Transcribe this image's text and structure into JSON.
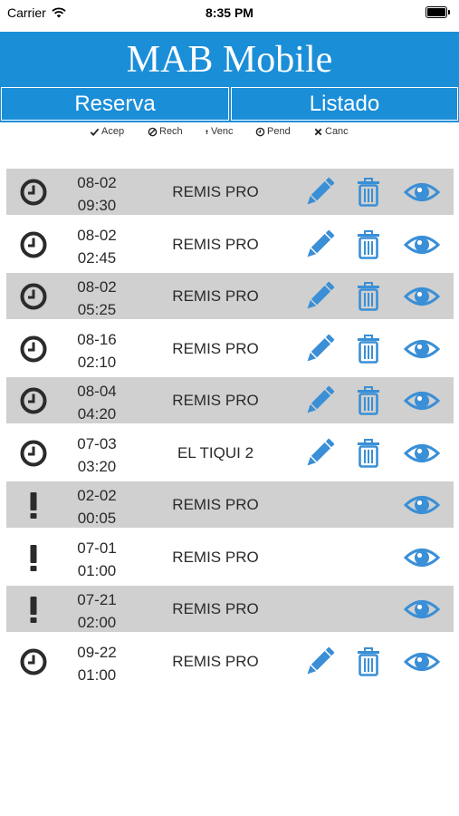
{
  "status_bar": {
    "carrier": "Carrier",
    "time": "8:35 PM"
  },
  "header": {
    "title": "MAB Mobile",
    "tabs": [
      {
        "label": "Reserva"
      },
      {
        "label": "Listado"
      }
    ]
  },
  "legend": [
    {
      "icon": "check-icon",
      "label": "Acep"
    },
    {
      "icon": "ban-icon",
      "label": "Rech"
    },
    {
      "icon": "exclamation-icon",
      "label": "Venc"
    },
    {
      "icon": "clock-icon",
      "label": "Pend"
    },
    {
      "icon": "x-icon",
      "label": "Canc"
    }
  ],
  "colors": {
    "header": "#1b8ed8",
    "action_icons": "#3a8fd6",
    "row_shade": "#d0d0d0"
  },
  "reservations": [
    {
      "date": "08-02",
      "time": "09:30",
      "company": "REMIS PRO",
      "status": "pending",
      "status_icon": "clock-icon",
      "editable": true
    },
    {
      "date": "08-02",
      "time": "02:45",
      "company": "REMIS PRO",
      "status": "pending",
      "status_icon": "clock-icon",
      "editable": true
    },
    {
      "date": "08-02",
      "time": "05:25",
      "company": "REMIS PRO",
      "status": "pending",
      "status_icon": "clock-icon",
      "editable": true
    },
    {
      "date": "08-16",
      "time": "02:10",
      "company": "REMIS PRO",
      "status": "pending",
      "status_icon": "clock-icon",
      "editable": true
    },
    {
      "date": "08-04",
      "time": "04:20",
      "company": "REMIS PRO",
      "status": "pending",
      "status_icon": "clock-icon",
      "editable": true
    },
    {
      "date": "07-03",
      "time": "03:20",
      "company": "EL TIQUI 2",
      "status": "pending",
      "status_icon": "clock-icon",
      "editable": true
    },
    {
      "date": "02-02",
      "time": "00:05",
      "company": "REMIS PRO",
      "status": "expired",
      "status_icon": "exclamation-icon",
      "editable": false
    },
    {
      "date": "07-01",
      "time": "01:00",
      "company": "REMIS PRO",
      "status": "expired",
      "status_icon": "exclamation-icon",
      "editable": false
    },
    {
      "date": "07-21",
      "time": "02:00",
      "company": "REMIS PRO",
      "status": "expired",
      "status_icon": "exclamation-icon",
      "editable": false
    },
    {
      "date": "09-22",
      "time": "01:00",
      "company": "REMIS PRO",
      "status": "pending",
      "status_icon": "clock-icon",
      "editable": true
    }
  ]
}
